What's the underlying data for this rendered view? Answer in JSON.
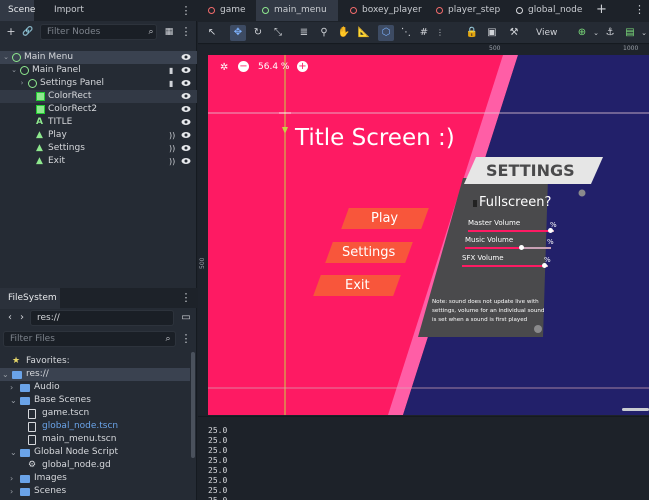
{
  "left_dock": {
    "tabs": [
      "Scene",
      "Import"
    ],
    "filter_nodes_placeholder": "Filter Nodes",
    "tree": [
      {
        "label": "Main Menu",
        "icon": "control-node-icon",
        "selected": true
      },
      {
        "label": "Main Panel",
        "icon": "control-node-icon"
      },
      {
        "label": "Settings Panel",
        "icon": "control-node-icon"
      },
      {
        "label": "ColorRect",
        "icon": "colorrect-icon",
        "highlighted": true
      },
      {
        "label": "ColorRect2",
        "icon": "colorrect-icon"
      },
      {
        "label": "TITLE",
        "icon": "label-icon"
      },
      {
        "label": "Play",
        "icon": "button-icon"
      },
      {
        "label": "Settings",
        "icon": "button-icon"
      },
      {
        "label": "Exit",
        "icon": "button-icon"
      }
    ],
    "filesystem": {
      "tab": "FileSystem",
      "path": "res://",
      "filter_placeholder": "Filter Files",
      "favorites_label": "Favorites:",
      "items": [
        {
          "label": "res://",
          "type": "folder",
          "selected": true
        },
        {
          "label": "Audio",
          "type": "folder"
        },
        {
          "label": "Base Scenes",
          "type": "folder"
        },
        {
          "label": "game.tscn",
          "type": "scene"
        },
        {
          "label": "global_node.tscn",
          "type": "scene",
          "accent": true
        },
        {
          "label": "main_menu.tscn",
          "type": "scene"
        },
        {
          "label": "Global Node Script",
          "type": "folder"
        },
        {
          "label": "global_node.gd",
          "type": "script"
        },
        {
          "label": "Images",
          "type": "folder"
        },
        {
          "label": "Scenes",
          "type": "folder"
        }
      ]
    }
  },
  "editor_tabs": [
    {
      "label": "game",
      "dot_color": "#f26b6b"
    },
    {
      "label": "main_menu",
      "dot_color": "#8ee88e",
      "active": true
    },
    {
      "label": "boxey_player",
      "dot_color": "#f26b6b"
    },
    {
      "label": "player_step",
      "dot_color": "#f26b6b"
    },
    {
      "label": "global_node",
      "dot_color": "#d6d8dc"
    }
  ],
  "toolbar": {
    "view_label": "View"
  },
  "viewport": {
    "zoom": "56.4 %",
    "ruler": {
      "r500": "500",
      "r1000": "1000",
      "v500": "500"
    },
    "scene": {
      "title": "Title Screen :)",
      "buttons": [
        "Play",
        "Settings",
        "Exit"
      ],
      "settings": {
        "header": "SETTINGS",
        "fullscreen": "Fullscreen?",
        "sliders": [
          {
            "label": "Master Volume",
            "unit": "%",
            "level": 0.95
          },
          {
            "label": "Music Volume",
            "unit": "%",
            "level": 0.65
          },
          {
            "label": "SFX Volume",
            "unit": "%",
            "level": 0.95
          }
        ],
        "note": "Note: sound does not update live with settings, volume for an individual sound is set when a sound is first played"
      }
    },
    "colors": {
      "pink": "#fe1a63",
      "navy": "#22206a",
      "button": "#f8563b",
      "panel": "#4a4a4c"
    }
  },
  "output": [
    "25.0",
    "25.0",
    "25.0",
    "25.0",
    "25.0",
    "25.0",
    "25.0",
    "25.0"
  ]
}
